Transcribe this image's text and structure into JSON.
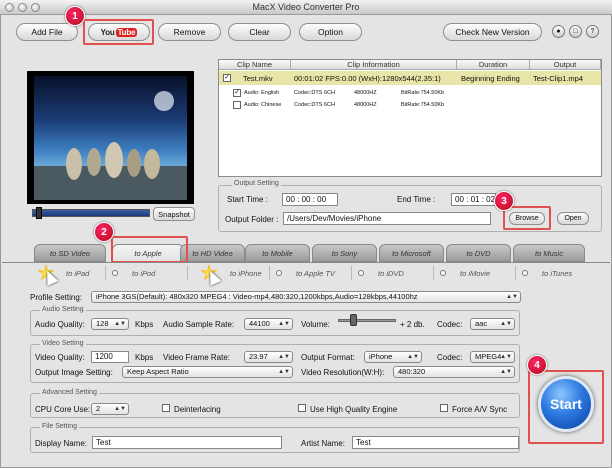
{
  "window": {
    "title": "MacX Video Converter Pro"
  },
  "toolbar": {
    "add_file": "Add File",
    "youtube_you": "You",
    "youtube_tube": "Tube",
    "remove": "Remove",
    "clear": "Clear",
    "option": "Option",
    "check_version": "Check New Version"
  },
  "badges": {
    "one": "1",
    "two": "2",
    "three": "3",
    "four": "4"
  },
  "preview": {
    "snapshot": "Snapshot"
  },
  "clip_table": {
    "headers": {
      "clip_name": "Clip Name",
      "clip_info": "Clip Information",
      "duration": "Duration",
      "output": "Output"
    },
    "main_row": {
      "name": "Test.mkv",
      "info": "00:01:02  FPS:0.00   (WxH):1280x544(2.35:1)",
      "duration": "Beginning Ending",
      "output": "Test-Clip1.mp4"
    },
    "audio_rows": [
      {
        "name": "Audio: English",
        "codec": "Codec:DTS 6CH",
        "hz": "48000HZ",
        "bitrate": "BitRate:754.50Kb"
      },
      {
        "name": "Audio: Chinese",
        "codec": "Codec:DTS 6CH",
        "hz": "48000HZ",
        "bitrate": "BitRate:754.50Kb"
      }
    ]
  },
  "output_setting": {
    "legend": "Output Setting",
    "start_label": "Start Time :",
    "start_value": "00 : 00 : 00",
    "end_label": "End Time :",
    "end_value": "00 : 01 : 02",
    "folder_label": "Output Folder :",
    "folder_value": "/Users/Dev/Movies/iPhone",
    "browse": "Browse",
    "open": "Open"
  },
  "tabs": [
    "to SD Video",
    "to Apple",
    "to HD Video",
    "to Mobile",
    "to Sony",
    "to Microsoft",
    "to DVD",
    "to Music"
  ],
  "subtabs": [
    "to iPad",
    "to iPod",
    "to iPhone",
    "to Apple TV",
    "to iDVD",
    "to iMovie",
    "to iTunes"
  ],
  "profile": {
    "label": "Profile Setting:",
    "value": "iPhone 3GS(Default): 480x320 MPEG4 : Video-mp4,480:320,1200kbps,Audio=128kbps,44100hz"
  },
  "audio_setting": {
    "legend": "Audio Setting",
    "quality_label": "Audio Quality:",
    "quality_value": "128",
    "quality_unit": "Kbps",
    "rate_label": "Audio Sample Rate:",
    "rate_value": "44100",
    "volume_label": "Volume:",
    "volume_value": "+ 2 db.",
    "codec_label": "Codec:",
    "codec_value": "aac"
  },
  "video_setting": {
    "legend": "Video Setting",
    "quality_label": "Video Quality:",
    "quality_value": "1200",
    "quality_unit": "Kbps",
    "frame_label": "Video Frame Rate:",
    "frame_value": "23.97",
    "format_label": "Output Format:",
    "format_value": "iPhone",
    "codec_label": "Codec:",
    "codec_value": "MPEG4",
    "image_label": "Output Image Setting:",
    "image_value": "Keep Aspect Ratio",
    "resolution_label": "Video Resolution(W:H):",
    "resolution_value": "480:320"
  },
  "advanced_setting": {
    "legend": "Advanced Setting",
    "cpu_label": "CPU Core Use:",
    "cpu_value": "2",
    "deinterlacing": "Deinterlacing",
    "high_quality": "Use High Quality Engine",
    "force_sync": "Force A/V Sync"
  },
  "file_setting": {
    "legend": "File Setting",
    "display_label": "Display Name:",
    "display_value": "Test",
    "artist_label": "Artist Name:",
    "artist_value": "Test"
  },
  "start_button": "Start",
  "colors": {
    "accent_red": "#e05050",
    "highlight_row": "#e7e6a8",
    "start_blue": "#2b78e0"
  }
}
